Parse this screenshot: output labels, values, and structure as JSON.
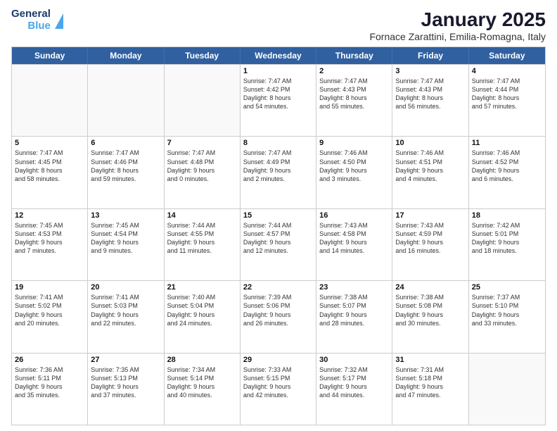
{
  "header": {
    "logo_line1": "General",
    "logo_line2": "Blue",
    "title": "January 2025",
    "subtitle": "Fornace Zarattini, Emilia-Romagna, Italy"
  },
  "days": [
    "Sunday",
    "Monday",
    "Tuesday",
    "Wednesday",
    "Thursday",
    "Friday",
    "Saturday"
  ],
  "weeks": [
    [
      {
        "num": "",
        "text": "",
        "empty": true
      },
      {
        "num": "",
        "text": "",
        "empty": true
      },
      {
        "num": "",
        "text": "",
        "empty": true
      },
      {
        "num": "1",
        "text": "Sunrise: 7:47 AM\nSunset: 4:42 PM\nDaylight: 8 hours\nand 54 minutes.",
        "empty": false
      },
      {
        "num": "2",
        "text": "Sunrise: 7:47 AM\nSunset: 4:43 PM\nDaylight: 8 hours\nand 55 minutes.",
        "empty": false
      },
      {
        "num": "3",
        "text": "Sunrise: 7:47 AM\nSunset: 4:43 PM\nDaylight: 8 hours\nand 56 minutes.",
        "empty": false
      },
      {
        "num": "4",
        "text": "Sunrise: 7:47 AM\nSunset: 4:44 PM\nDaylight: 8 hours\nand 57 minutes.",
        "empty": false
      }
    ],
    [
      {
        "num": "5",
        "text": "Sunrise: 7:47 AM\nSunset: 4:45 PM\nDaylight: 8 hours\nand 58 minutes.",
        "empty": false
      },
      {
        "num": "6",
        "text": "Sunrise: 7:47 AM\nSunset: 4:46 PM\nDaylight: 8 hours\nand 59 minutes.",
        "empty": false
      },
      {
        "num": "7",
        "text": "Sunrise: 7:47 AM\nSunset: 4:48 PM\nDaylight: 9 hours\nand 0 minutes.",
        "empty": false
      },
      {
        "num": "8",
        "text": "Sunrise: 7:47 AM\nSunset: 4:49 PM\nDaylight: 9 hours\nand 2 minutes.",
        "empty": false
      },
      {
        "num": "9",
        "text": "Sunrise: 7:46 AM\nSunset: 4:50 PM\nDaylight: 9 hours\nand 3 minutes.",
        "empty": false
      },
      {
        "num": "10",
        "text": "Sunrise: 7:46 AM\nSunset: 4:51 PM\nDaylight: 9 hours\nand 4 minutes.",
        "empty": false
      },
      {
        "num": "11",
        "text": "Sunrise: 7:46 AM\nSunset: 4:52 PM\nDaylight: 9 hours\nand 6 minutes.",
        "empty": false
      }
    ],
    [
      {
        "num": "12",
        "text": "Sunrise: 7:45 AM\nSunset: 4:53 PM\nDaylight: 9 hours\nand 7 minutes.",
        "empty": false
      },
      {
        "num": "13",
        "text": "Sunrise: 7:45 AM\nSunset: 4:54 PM\nDaylight: 9 hours\nand 9 minutes.",
        "empty": false
      },
      {
        "num": "14",
        "text": "Sunrise: 7:44 AM\nSunset: 4:55 PM\nDaylight: 9 hours\nand 11 minutes.",
        "empty": false
      },
      {
        "num": "15",
        "text": "Sunrise: 7:44 AM\nSunset: 4:57 PM\nDaylight: 9 hours\nand 12 minutes.",
        "empty": false
      },
      {
        "num": "16",
        "text": "Sunrise: 7:43 AM\nSunset: 4:58 PM\nDaylight: 9 hours\nand 14 minutes.",
        "empty": false
      },
      {
        "num": "17",
        "text": "Sunrise: 7:43 AM\nSunset: 4:59 PM\nDaylight: 9 hours\nand 16 minutes.",
        "empty": false
      },
      {
        "num": "18",
        "text": "Sunrise: 7:42 AM\nSunset: 5:01 PM\nDaylight: 9 hours\nand 18 minutes.",
        "empty": false
      }
    ],
    [
      {
        "num": "19",
        "text": "Sunrise: 7:41 AM\nSunset: 5:02 PM\nDaylight: 9 hours\nand 20 minutes.",
        "empty": false
      },
      {
        "num": "20",
        "text": "Sunrise: 7:41 AM\nSunset: 5:03 PM\nDaylight: 9 hours\nand 22 minutes.",
        "empty": false
      },
      {
        "num": "21",
        "text": "Sunrise: 7:40 AM\nSunset: 5:04 PM\nDaylight: 9 hours\nand 24 minutes.",
        "empty": false
      },
      {
        "num": "22",
        "text": "Sunrise: 7:39 AM\nSunset: 5:06 PM\nDaylight: 9 hours\nand 26 minutes.",
        "empty": false
      },
      {
        "num": "23",
        "text": "Sunrise: 7:38 AM\nSunset: 5:07 PM\nDaylight: 9 hours\nand 28 minutes.",
        "empty": false
      },
      {
        "num": "24",
        "text": "Sunrise: 7:38 AM\nSunset: 5:08 PM\nDaylight: 9 hours\nand 30 minutes.",
        "empty": false
      },
      {
        "num": "25",
        "text": "Sunrise: 7:37 AM\nSunset: 5:10 PM\nDaylight: 9 hours\nand 33 minutes.",
        "empty": false
      }
    ],
    [
      {
        "num": "26",
        "text": "Sunrise: 7:36 AM\nSunset: 5:11 PM\nDaylight: 9 hours\nand 35 minutes.",
        "empty": false
      },
      {
        "num": "27",
        "text": "Sunrise: 7:35 AM\nSunset: 5:13 PM\nDaylight: 9 hours\nand 37 minutes.",
        "empty": false
      },
      {
        "num": "28",
        "text": "Sunrise: 7:34 AM\nSunset: 5:14 PM\nDaylight: 9 hours\nand 40 minutes.",
        "empty": false
      },
      {
        "num": "29",
        "text": "Sunrise: 7:33 AM\nSunset: 5:15 PM\nDaylight: 9 hours\nand 42 minutes.",
        "empty": false
      },
      {
        "num": "30",
        "text": "Sunrise: 7:32 AM\nSunset: 5:17 PM\nDaylight: 9 hours\nand 44 minutes.",
        "empty": false
      },
      {
        "num": "31",
        "text": "Sunrise: 7:31 AM\nSunset: 5:18 PM\nDaylight: 9 hours\nand 47 minutes.",
        "empty": false
      },
      {
        "num": "",
        "text": "",
        "empty": true
      }
    ]
  ]
}
